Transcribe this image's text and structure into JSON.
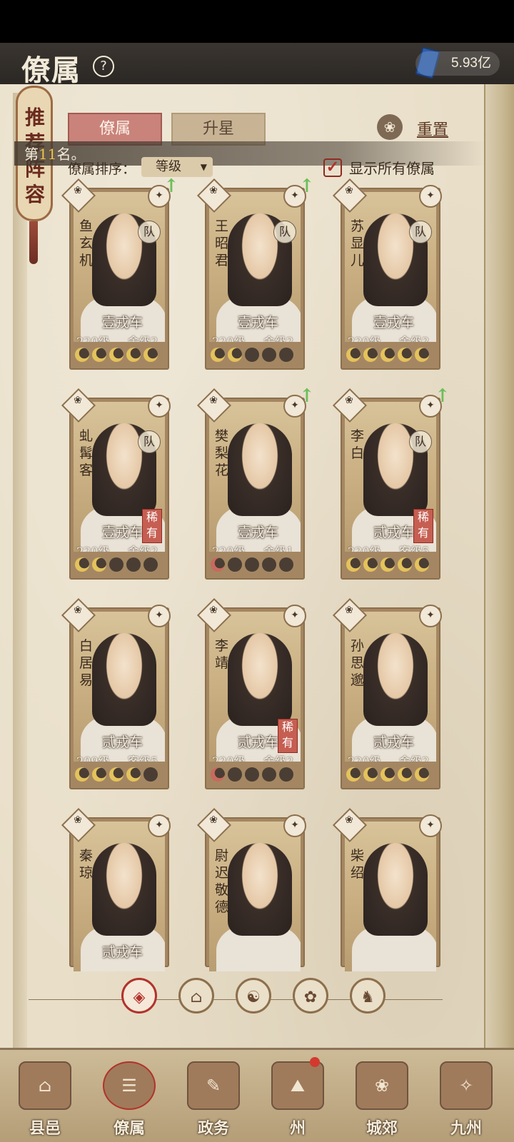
{
  "header": {
    "title": "僚属",
    "currency": "5.93亿"
  },
  "banner": {
    "text": "推荐阵容"
  },
  "tabs": {
    "active": "僚属",
    "inactive": "升星"
  },
  "reset": {
    "label": "重置"
  },
  "rank": {
    "prefix": "第",
    "number": "11",
    "suffix": "名。"
  },
  "sort": {
    "label": "僚属排序：",
    "value": "等级"
  },
  "show_all": {
    "label": "显示所有僚属",
    "checked": true
  },
  "cards": [
    {
      "name": "鱼玄机",
      "carriage": "壹戎车",
      "level": "220级",
      "house": "舍级2阶",
      "team": "队",
      "rare": "",
      "moons": 5,
      "upgrade": true
    },
    {
      "name": "王昭君",
      "carriage": "壹戎车",
      "level": "220级",
      "house": "舍级2阶",
      "team": "队",
      "rare": "",
      "moons": 2,
      "upgrade": true
    },
    {
      "name": "苏显儿",
      "carriage": "壹戎车",
      "level": "220级",
      "house": "舍级2阶",
      "team": "队",
      "rare": "",
      "moons": 5,
      "upgrade": false
    },
    {
      "name": "虬髯客",
      "carriage": "壹戎车",
      "level": "220级",
      "house": "舍级2阶",
      "team": "队",
      "rare": "稀有",
      "moons": 2,
      "upgrade": false
    },
    {
      "name": "樊梨花",
      "carriage": "壹戎车",
      "level": "220级",
      "house": "舍级1阶",
      "team": "",
      "rare": "",
      "moons": 1,
      "upgrade": true
    },
    {
      "name": "李白",
      "carriage": "贰戎车",
      "level": "220级",
      "house": "客级5阶",
      "team": "队",
      "rare": "稀有",
      "moons": 5,
      "upgrade": true
    },
    {
      "name": "白居易",
      "carriage": "贰戎车",
      "level": "209级",
      "house": "客级5阶",
      "team": "",
      "rare": "",
      "moons": 4,
      "upgrade": false
    },
    {
      "name": "李靖",
      "carriage": "贰戎车",
      "level": "220级",
      "house": "舍级2阶",
      "team": "",
      "rare": "稀有",
      "moons": 1,
      "upgrade": false
    },
    {
      "name": "孙思邈",
      "carriage": "贰戎车",
      "level": "220级",
      "house": "舍级2阶",
      "team": "",
      "rare": "",
      "moons": 5,
      "upgrade": false
    },
    {
      "name": "秦琼",
      "carriage": "贰戎车",
      "level": "",
      "house": "",
      "team": "",
      "rare": "",
      "moons": 0,
      "upgrade": false
    },
    {
      "name": "尉迟敬德",
      "carriage": "",
      "level": "",
      "house": "",
      "team": "",
      "rare": "",
      "moons": 0,
      "upgrade": false
    },
    {
      "name": "柴绍",
      "carriage": "",
      "level": "",
      "house": "",
      "team": "",
      "rare": "",
      "moons": 0,
      "upgrade": false
    }
  ],
  "filters": [
    {
      "icon": "all-icon",
      "glyph": "◈",
      "active": true
    },
    {
      "icon": "class-a-icon",
      "glyph": "⌂",
      "active": false
    },
    {
      "icon": "class-b-icon",
      "glyph": "☯",
      "active": false
    },
    {
      "icon": "class-c-icon",
      "glyph": "✿",
      "active": false
    },
    {
      "icon": "class-d-icon",
      "glyph": "♞",
      "active": false
    }
  ],
  "nav": [
    {
      "label": "县邑",
      "icon": "city-icon",
      "glyph": "⌂"
    },
    {
      "label": "僚属",
      "icon": "retainers-icon",
      "glyph": "☰"
    },
    {
      "label": "政务",
      "icon": "affairs-icon",
      "glyph": "✎"
    },
    {
      "label": "州",
      "icon": "prefecture-icon",
      "glyph": "⛰"
    },
    {
      "label": "城郊",
      "icon": "suburb-icon",
      "glyph": "❀"
    },
    {
      "label": "九州",
      "icon": "map-icon",
      "glyph": "✧"
    }
  ],
  "colors": {
    "accent": "#b2322b",
    "parchment": "#e9dfc9",
    "upgrade": "#6bbf5a",
    "moon": "#e4c25c"
  }
}
